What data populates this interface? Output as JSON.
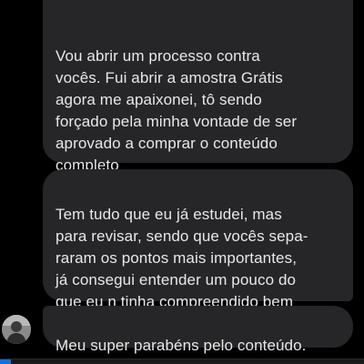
{
  "messages": [
    {
      "text": "Vou abrir um processo contra\nvocês.  Fui  abrir  a amostra Grátis\nagora me apaixonei, tô sendo\nforçado pela minha vontade de ser\naprovado a comprar o conteúdo\ncompleto"
    },
    {
      "text": "Tem tudo que eu já estudei, mas\npara revisar, sendo que vocês sepa-\nraram os pontos mais importantes,\njá consegui entender um pouco do\nque eu n tinha compreendido bem"
    },
    {
      "text": "Meu super parabéns pelo conteúdo."
    }
  ],
  "avatar": {
    "icon": "user-avatar"
  },
  "colors": {
    "background": "#000000",
    "bubble": "#262628",
    "text": "#e8e8e8",
    "accent": "#1a6ed8"
  }
}
